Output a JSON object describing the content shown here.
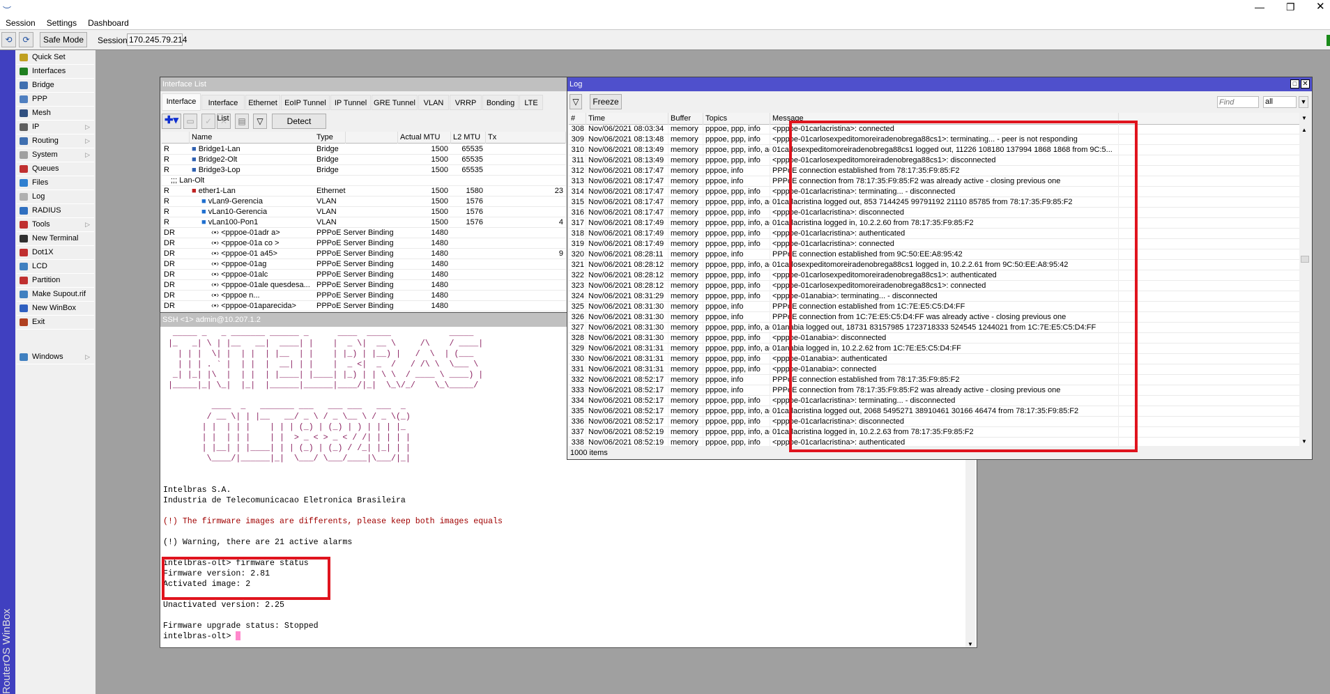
{
  "menubar": {
    "items": [
      "Session",
      "Settings",
      "Dashboard"
    ]
  },
  "window_controls": {
    "minimize": "—",
    "restore": "❐",
    "close": "✕"
  },
  "toolbar": {
    "undo": "⟲",
    "redo": "⟳",
    "safe_mode": "Safe Mode",
    "session_label": "Session:",
    "session_value": "170.245.79.214"
  },
  "brand": "RouterOS WinBox",
  "sidebar": {
    "items": [
      {
        "label": "Quick Set",
        "icon": "wand-icon",
        "color": "#c0a020",
        "arrow": false
      },
      {
        "label": "Interfaces",
        "icon": "interfaces-icon",
        "color": "#208020",
        "arrow": false
      },
      {
        "label": "Bridge",
        "icon": "bridge-icon",
        "color": "#4070b0",
        "arrow": false
      },
      {
        "label": "PPP",
        "icon": "ppp-icon",
        "color": "#5080c0",
        "arrow": false
      },
      {
        "label": "Mesh",
        "icon": "mesh-icon",
        "color": "#305080",
        "arrow": false
      },
      {
        "label": "IP",
        "icon": "ip-icon",
        "color": "#606060",
        "arrow": true
      },
      {
        "label": "Routing",
        "icon": "routing-icon",
        "color": "#4070b0",
        "arrow": true
      },
      {
        "label": "System",
        "icon": "gear-icon",
        "color": "#a0a0a0",
        "arrow": true
      },
      {
        "label": "Queues",
        "icon": "queues-icon",
        "color": "#c03030",
        "arrow": false
      },
      {
        "label": "Files",
        "icon": "folder-icon",
        "color": "#3080d0",
        "arrow": false
      },
      {
        "label": "Log",
        "icon": "log-icon",
        "color": "#b0b0b0",
        "arrow": false
      },
      {
        "label": "RADIUS",
        "icon": "radius-icon",
        "color": "#3070c0",
        "arrow": false
      },
      {
        "label": "Tools",
        "icon": "tools-icon",
        "color": "#c03030",
        "arrow": true
      },
      {
        "label": "New Terminal",
        "icon": "terminal-icon",
        "color": "#303030",
        "arrow": false
      },
      {
        "label": "Dot1X",
        "icon": "dot1x-icon",
        "color": "#c03030",
        "arrow": false
      },
      {
        "label": "LCD",
        "icon": "lcd-icon",
        "color": "#4080c0",
        "arrow": false
      },
      {
        "label": "Partition",
        "icon": "partition-icon",
        "color": "#c03030",
        "arrow": false
      },
      {
        "label": "Make Supout.rif",
        "icon": "supout-icon",
        "color": "#4080c0",
        "arrow": false
      },
      {
        "label": "New WinBox",
        "icon": "winbox-icon",
        "color": "#3060c0",
        "arrow": false
      },
      {
        "label": "Exit",
        "icon": "exit-icon",
        "color": "#b04020",
        "arrow": false
      }
    ],
    "windows": {
      "label": "Windows",
      "icon": "windows-icon",
      "color": "#4080c0"
    }
  },
  "interface_list": {
    "title": "Interface List",
    "tabs": [
      "Interface",
      "Interface List",
      "Ethernet",
      "EoIP Tunnel",
      "IP Tunnel",
      "GRE Tunnel",
      "VLAN",
      "VRRP",
      "Bonding",
      "LTE"
    ],
    "detect_internet": "Detect Internet",
    "columns": [
      "",
      "Name",
      "Type",
      "Actual MTU",
      "L2 MTU",
      "Tx"
    ],
    "rows": [
      {
        "flag": "R",
        "name": "Bridge1-Lan",
        "type": "Bridge",
        "mtu": "1500",
        "l2mtu": "65535",
        "tx": "",
        "indent": 0,
        "icon": "bridge-icon"
      },
      {
        "flag": "R",
        "name": "Bridge2-Olt",
        "type": "Bridge",
        "mtu": "1500",
        "l2mtu": "65535",
        "tx": "",
        "indent": 0,
        "icon": "bridge-icon"
      },
      {
        "flag": "R",
        "name": "Bridge3-Lop",
        "type": "Bridge",
        "mtu": "1500",
        "l2mtu": "65535",
        "tx": "",
        "indent": 0,
        "icon": "bridge-icon"
      },
      {
        "comment": ";;; Lan-Olt"
      },
      {
        "flag": "R",
        "name": "ether1-Lan",
        "type": "Ethernet",
        "mtu": "1500",
        "l2mtu": "1580",
        "tx": "23",
        "indent": 0,
        "icon": "ethernet-icon"
      },
      {
        "flag": "R",
        "name": "vLan9-Gerencia",
        "type": "VLAN",
        "mtu": "1500",
        "l2mtu": "1576",
        "tx": "",
        "indent": 1,
        "icon": "vlan-icon"
      },
      {
        "flag": "R",
        "name": "vLan10-Gerencia",
        "type": "VLAN",
        "mtu": "1500",
        "l2mtu": "1576",
        "tx": "",
        "indent": 1,
        "icon": "vlan-icon"
      },
      {
        "flag": "R",
        "name": "vLan100-Pon1",
        "type": "VLAN",
        "mtu": "1500",
        "l2mtu": "1576",
        "tx": "4",
        "indent": 1,
        "icon": "vlan-icon"
      },
      {
        "flag": "DR",
        "name": "<pppoe-01adr      a>",
        "type": "PPPoE Server Binding",
        "mtu": "1480",
        "l2mtu": "",
        "tx": "",
        "indent": 2,
        "icon": "pppoe-binding-icon"
      },
      {
        "flag": "DR",
        "name": "<pppoe-01a      co    >",
        "type": "PPPoE Server Binding",
        "mtu": "1480",
        "l2mtu": "",
        "tx": "",
        "indent": 2,
        "icon": "pppoe-binding-icon"
      },
      {
        "flag": "DR",
        "name": "<pppoe-01            a45>",
        "type": "PPPoE Server Binding",
        "mtu": "1480",
        "l2mtu": "",
        "tx": "9",
        "indent": 2,
        "icon": "pppoe-binding-icon"
      },
      {
        "flag": "DR",
        "name": "<pppoe-01ag",
        "type": "PPPoE Server Binding",
        "mtu": "1480",
        "l2mtu": "",
        "tx": "",
        "indent": 2,
        "icon": "pppoe-binding-icon"
      },
      {
        "flag": "DR",
        "name": "<pppoe-01alc",
        "type": "PPPoE Server Binding",
        "mtu": "1480",
        "l2mtu": "",
        "tx": "",
        "indent": 2,
        "icon": "pppoe-binding-icon"
      },
      {
        "flag": "DR",
        "name": "<pppoe-01ale         quesdesa...",
        "type": "PPPoE Server Binding",
        "mtu": "1480",
        "l2mtu": "",
        "tx": "",
        "indent": 2,
        "icon": "pppoe-binding-icon"
      },
      {
        "flag": "DR",
        "name": "<pppoe              n...",
        "type": "PPPoE Server Binding",
        "mtu": "1480",
        "l2mtu": "",
        "tx": "",
        "indent": 2,
        "icon": "pppoe-binding-icon"
      },
      {
        "flag": "DR",
        "name": "<pppoe-01aparecida>",
        "type": "PPPoE Server Binding",
        "mtu": "1480",
        "l2mtu": "",
        "tx": "",
        "indent": 2,
        "icon": "pppoe-binding-icon"
      }
    ]
  },
  "terminal": {
    "title": "SSH <1> admin@10.207.1.2",
    "lines": [
      {
        "t": "  _____ _   _ _______ ______ _      ____  _____            _____ ",
        "c": "art"
      },
      {
        "t": " |_   _| \\ | |__   __|  ____| |    |  _ \\|  __ \\     /\\    / ____|",
        "c": "art"
      },
      {
        "t": "   | | |  \\| |  | |  | |__  | |    | |_) | |__) |   /  \\  | (___  ",
        "c": "art"
      },
      {
        "t": "   | | | . ` |  | |  |  __| | |    |  _ <|  _  /   / /\\ \\  \\___ \\ ",
        "c": "art"
      },
      {
        "t": "  _| |_| |\\  |  | |  | |____| |____| |_) | | \\ \\  / ____ \\ ____) |",
        "c": "art"
      },
      {
        "t": " |_____|_| \\_|  |_|  |______|______|____/|_|  \\_\\/_/    \\_\\_____/ ",
        "c": "art"
      },
      {
        "t": "",
        "c": ""
      },
      {
        "t": "          ____  _   _______ ___   ___ ___   ___  _ ",
        "c": "art"
      },
      {
        "t": "         / __ \\| | |__   __/ _ \\ / _ \\__ \\ / _ \\(_)",
        "c": "art"
      },
      {
        "t": "        | |  | | |    | | | (_) | (_) | ) | | | |_ ",
        "c": "art"
      },
      {
        "t": "        | |  | | |    | |  > _ < > _ < / /| | | | |",
        "c": "art"
      },
      {
        "t": "        | |__| | |____| | | (_) | (_) / /_| |_| | |",
        "c": "art"
      },
      {
        "t": "         \\____/|______|_|  \\___/ \\___/____|\\___/|_|",
        "c": "art"
      },
      {
        "t": "",
        "c": ""
      },
      {
        "t": "",
        "c": ""
      },
      {
        "t": "Intelbras S.A.",
        "c": ""
      },
      {
        "t": "Industria de Telecomunicacao Eletronica Brasileira",
        "c": ""
      },
      {
        "t": "",
        "c": ""
      },
      {
        "t": "(!) The firmware images are differents, please keep both images equals",
        "c": "red"
      },
      {
        "t": "",
        "c": ""
      },
      {
        "t": "(!) Warning, there are 21 active alarms",
        "c": ""
      },
      {
        "t": "",
        "c": ""
      },
      {
        "t": "intelbras-olt> firmware status",
        "c": ""
      },
      {
        "t": "Firmware version: 2.81",
        "c": ""
      },
      {
        "t": "Activated image: 2",
        "c": ""
      },
      {
        "t": "",
        "c": ""
      },
      {
        "t": "Unactivated version: 2.25",
        "c": ""
      },
      {
        "t": "",
        "c": ""
      },
      {
        "t": "Firmware upgrade status: Stopped",
        "c": ""
      }
    ],
    "prompt": "intelbras-olt> "
  },
  "log": {
    "title": "Log",
    "freeze": "Freeze",
    "find_placeholder": "Find",
    "filter_value": "all",
    "columns": [
      "#",
      "Time",
      "Buffer",
      "Topics",
      "Message"
    ],
    "footer": "1000 items",
    "title_color": "#4f50cc",
    "rows": [
      [
        "308",
        "Nov/06/2021 08:03:34",
        "memory",
        "pppoe, ppp, info",
        "<pppoe-01carlacristina>: connected"
      ],
      [
        "309",
        "Nov/06/2021 08:13:48",
        "memory",
        "pppoe, ppp, info",
        "<pppoe-01carlosexpeditomoreiradenobrega88cs1>: terminating... - peer is not responding"
      ],
      [
        "310",
        "Nov/06/2021 08:13:49",
        "memory",
        "pppoe, ppp, info, acc...",
        "01carlosexpeditomoreiradenobrega88cs1 logged out, 11226 108180 137994 1868 1868 from 9C:5..."
      ],
      [
        "311",
        "Nov/06/2021 08:13:49",
        "memory",
        "pppoe, ppp, info",
        "<pppoe-01carlosexpeditomoreiradenobrega88cs1>: disconnected"
      ],
      [
        "312",
        "Nov/06/2021 08:17:47",
        "memory",
        "pppoe, info",
        "PPPoE connection established from 78:17:35:F9:85:F2"
      ],
      [
        "313",
        "Nov/06/2021 08:17:47",
        "memory",
        "pppoe, info",
        "PPPoE connection from 78:17:35:F9:85:F2 was already active - closing previous one"
      ],
      [
        "314",
        "Nov/06/2021 08:17:47",
        "memory",
        "pppoe, ppp, info",
        "<pppoe-01carlacristina>: terminating... - disconnected"
      ],
      [
        "315",
        "Nov/06/2021 08:17:47",
        "memory",
        "pppoe, ppp, info, acc...",
        "01carlacristina logged out, 853 7144245 99791192 21110 85785 from 78:17:35:F9:85:F2"
      ],
      [
        "316",
        "Nov/06/2021 08:17:47",
        "memory",
        "pppoe, ppp, info",
        "<pppoe-01carlacristina>: disconnected"
      ],
      [
        "317",
        "Nov/06/2021 08:17:49",
        "memory",
        "pppoe, ppp, info, acc...",
        "01carlacristina logged in, 10.2.2.60 from 78:17:35:F9:85:F2"
      ],
      [
        "318",
        "Nov/06/2021 08:17:49",
        "memory",
        "pppoe, ppp, info",
        "<pppoe-01carlacristina>: authenticated"
      ],
      [
        "319",
        "Nov/06/2021 08:17:49",
        "memory",
        "pppoe, ppp, info",
        "<pppoe-01carlacristina>: connected"
      ],
      [
        "320",
        "Nov/06/2021 08:28:11",
        "memory",
        "pppoe, info",
        "PPPoE connection established from 9C:50:EE:A8:95:42"
      ],
      [
        "321",
        "Nov/06/2021 08:28:12",
        "memory",
        "pppoe, ppp, info, acc...",
        "01carlosexpeditomoreiradenobrega88cs1 logged in, 10.2.2.61 from 9C:50:EE:A8:95:42"
      ],
      [
        "322",
        "Nov/06/2021 08:28:12",
        "memory",
        "pppoe, ppp, info",
        "<pppoe-01carlosexpeditomoreiradenobrega88cs1>: authenticated"
      ],
      [
        "323",
        "Nov/06/2021 08:28:12",
        "memory",
        "pppoe, ppp, info",
        "<pppoe-01carlosexpeditomoreiradenobrega88cs1>: connected"
      ],
      [
        "324",
        "Nov/06/2021 08:31:29",
        "memory",
        "pppoe, ppp, info",
        "<pppoe-01anabia>: terminating... - disconnected"
      ],
      [
        "325",
        "Nov/06/2021 08:31:30",
        "memory",
        "pppoe, info",
        "PPPoE connection established from 1C:7E:E5:C5:D4:FF"
      ],
      [
        "326",
        "Nov/06/2021 08:31:30",
        "memory",
        "pppoe, info",
        "PPPoE connection from 1C:7E:E5:C5:D4:FF was already active - closing previous one"
      ],
      [
        "327",
        "Nov/06/2021 08:31:30",
        "memory",
        "pppoe, ppp, info, acc...",
        "01anabia logged out, 18731 83157985 1723718333 524545 1244021 from 1C:7E:E5:C5:D4:FF"
      ],
      [
        "328",
        "Nov/06/2021 08:31:30",
        "memory",
        "pppoe, ppp, info",
        "<pppoe-01anabia>: disconnected"
      ],
      [
        "329",
        "Nov/06/2021 08:31:31",
        "memory",
        "pppoe, ppp, info, acc...",
        "01anabia logged in, 10.2.2.62 from 1C:7E:E5:C5:D4:FF"
      ],
      [
        "330",
        "Nov/06/2021 08:31:31",
        "memory",
        "pppoe, ppp, info",
        "<pppoe-01anabia>: authenticated"
      ],
      [
        "331",
        "Nov/06/2021 08:31:31",
        "memory",
        "pppoe, ppp, info",
        "<pppoe-01anabia>: connected"
      ],
      [
        "332",
        "Nov/06/2021 08:52:17",
        "memory",
        "pppoe, info",
        "PPPoE connection established from 78:17:35:F9:85:F2"
      ],
      [
        "333",
        "Nov/06/2021 08:52:17",
        "memory",
        "pppoe, info",
        "PPPoE connection from 78:17:35:F9:85:F2 was already active - closing previous one"
      ],
      [
        "334",
        "Nov/06/2021 08:52:17",
        "memory",
        "pppoe, ppp, info",
        "<pppoe-01carlacristina>: terminating... - disconnected"
      ],
      [
        "335",
        "Nov/06/2021 08:52:17",
        "memory",
        "pppoe, ppp, info, acc...",
        "01carlacristina logged out, 2068 5495271 38910461 30166 46474 from 78:17:35:F9:85:F2"
      ],
      [
        "336",
        "Nov/06/2021 08:52:17",
        "memory",
        "pppoe, ppp, info",
        "<pppoe-01carlacristina>: disconnected"
      ],
      [
        "337",
        "Nov/06/2021 08:52:19",
        "memory",
        "pppoe, ppp, info, acc...",
        "01carlacristina logged in, 10.2.2.63 from 78:17:35:F9:85:F2"
      ],
      [
        "338",
        "Nov/06/2021 08:52:19",
        "memory",
        "pppoe, ppp, info",
        "<pppoe-01carlacristina>: authenticated"
      ]
    ]
  },
  "highlight_color": "#e0141e"
}
